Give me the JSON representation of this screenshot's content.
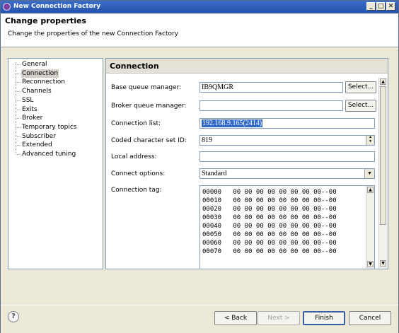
{
  "window": {
    "title": "New Connection Factory",
    "minimize": "_",
    "maximize": "□",
    "close": "✕"
  },
  "header": {
    "title": "Change properties",
    "description": "Change the properties of the new Connection Factory"
  },
  "nav": {
    "items": [
      {
        "label": "General"
      },
      {
        "label": "Connection"
      },
      {
        "label": "Reconnection"
      },
      {
        "label": "Channels"
      },
      {
        "label": "SSL"
      },
      {
        "label": "Exits"
      },
      {
        "label": "Broker"
      },
      {
        "label": "Temporary topics"
      },
      {
        "label": "Subscriber"
      },
      {
        "label": "Extended"
      },
      {
        "label": "Advanced tuning"
      }
    ],
    "selected": "Connection"
  },
  "panel": {
    "title": "Connection",
    "base_qm_label": "Base queue manager:",
    "base_qm_value": "IB9QMGR",
    "broker_qm_label": "Broker queue manager:",
    "broker_qm_value": "",
    "select_label": "Select...",
    "conn_list_label": "Connection list:",
    "conn_list_value": "192.168.9.165(2414)",
    "ccsid_label": "Coded character set ID:",
    "ccsid_value": "819",
    "local_addr_label": "Local address:",
    "local_addr_value": "",
    "connect_opts_label": "Connect options:",
    "connect_opts_value": "Standard",
    "conn_tag_label": "Connection tag:",
    "hex_rows": [
      "00000   00 00 00 00 00 00 00 00--00",
      "00010   00 00 00 00 00 00 00 00--00",
      "00020   00 00 00 00 00 00 00 00--00",
      "00030   00 00 00 00 00 00 00 00--00",
      "00040   00 00 00 00 00 00 00 00--00",
      "00050   00 00 00 00 00 00 00 00--00",
      "00060   00 00 00 00 00 00 00 00--00",
      "00070   00 00 00 00 00 00 00 00--00"
    ]
  },
  "footer": {
    "help": "?",
    "back": "< Back",
    "next": "Next >",
    "finish": "Finish",
    "cancel": "Cancel"
  },
  "colors": {
    "titlebar": "#2451a8",
    "selection": "#316ac5",
    "dialog_bg": "#ece9d8"
  }
}
